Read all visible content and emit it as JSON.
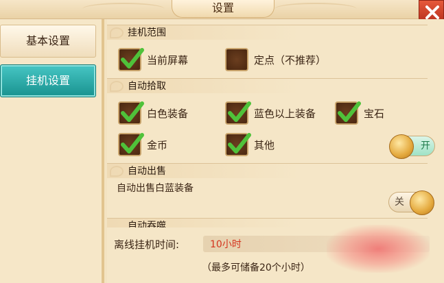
{
  "window": {
    "title": "设置"
  },
  "sidebar": {
    "items": [
      {
        "label": "基本设置",
        "active": false
      },
      {
        "label": "挂机设置",
        "active": true
      }
    ]
  },
  "sections": {
    "range": {
      "title": "挂机范围",
      "options": [
        {
          "label": "当前屏幕",
          "checked": true
        },
        {
          "label": "定点（不推荐）",
          "checked": false
        }
      ]
    },
    "pickup": {
      "title": "自动拾取",
      "options": [
        {
          "label": "白色装备",
          "checked": true
        },
        {
          "label": "蓝色以上装备",
          "checked": true
        },
        {
          "label": "宝石",
          "checked": true
        },
        {
          "label": "金币",
          "checked": true
        },
        {
          "label": "其他",
          "checked": true
        }
      ],
      "toggle": {
        "label": "开",
        "on": true
      }
    },
    "sell": {
      "title": "自动出售",
      "description": "自动出售白蓝装备",
      "toggle": {
        "label": "关",
        "on": false
      }
    },
    "devour": {
      "title": "自动吞噬"
    }
  },
  "offline": {
    "label": "离线挂机时间:",
    "value": "10小时",
    "note": "（最多可储备20个小时）"
  },
  "icons": {
    "close": "close-icon",
    "check": "checkmark-icon"
  },
  "colors": {
    "accent_teal": "#19928f",
    "check_green": "#4fc23a",
    "value_red": "#d4341e",
    "close_red": "#c7341f"
  }
}
